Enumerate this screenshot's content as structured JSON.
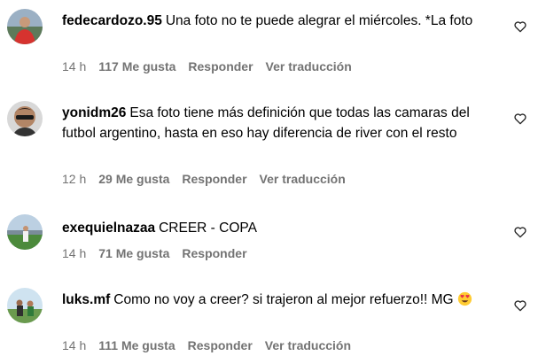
{
  "comments": [
    {
      "username": "fedecardozo.95",
      "text": "Una foto no te puede alegrar el miércoles. *La foto",
      "time": "14 h",
      "likes": "117 Me gusta",
      "reply": "Responder",
      "translate": "Ver traducción",
      "avatar": "avatar-red-shirt"
    },
    {
      "username": "yonidm26",
      "text": "Esa foto tiene más definición que todas las camaras del futbol argentino, hasta en eso hay diferencia de river con el resto",
      "time": "12 h",
      "likes": "29 Me gusta",
      "reply": "Responder",
      "translate": "Ver traducción",
      "avatar": "avatar-sunglasses"
    },
    {
      "username": "exequielnazaa",
      "text": "CREER - COPA",
      "time": "14 h",
      "likes": "71 Me gusta",
      "reply": "Responder",
      "avatar": "avatar-field"
    },
    {
      "username": "luks.mf",
      "text": "Como no voy a creer? si trajeron al mejor refuerzo!! MG",
      "time": "14 h",
      "likes": "111 Me gusta",
      "reply": "Responder",
      "translate": "Ver traducción",
      "avatar": "avatar-group",
      "emoji": "heart-eyes-emoji"
    }
  ],
  "icons": {
    "like": "heart-outline-icon"
  },
  "colors": {
    "meta": "#737373",
    "text": "#000000"
  }
}
